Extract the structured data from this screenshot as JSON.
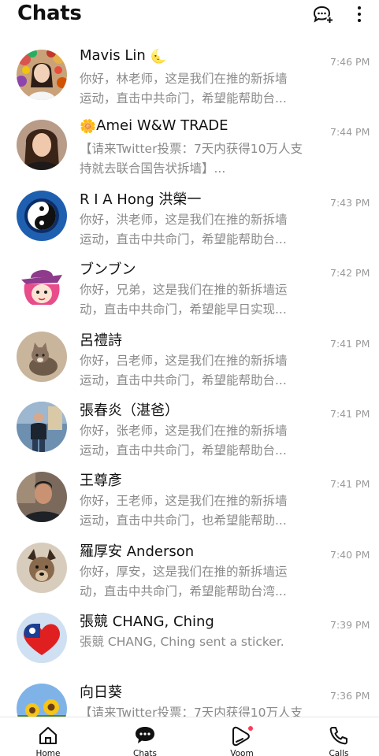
{
  "header": {
    "title": "Chats",
    "new_chat_icon": "chat-plus-icon",
    "more_icon": "more-vertical-icon"
  },
  "chats": [
    {
      "name": "Mavis Lin",
      "emoji": "🌜",
      "line1": "你好，林老师，这是我们在推的新拆墙",
      "line2": "运动，直击中共命门，希望能帮助台...",
      "time": "7:46 PM",
      "avatar": "woman-flowers-avatar"
    },
    {
      "name": "Amei W&W TRADE",
      "emoji": "🌼",
      "line1": "【请来Twitter投票：7天内获得10万人支",
      "line2": "持就去联合国告状拆墙】...",
      "time": "7:44 PM",
      "avatar": "woman-portrait-avatar"
    },
    {
      "name": "R I A Hong 洪榮一",
      "emoji": "",
      "line1": "你好，洪老师，这是我们在推的新拆墙",
      "line2": "运动，直击中共命门，希望能帮助台...",
      "time": "7:43 PM",
      "avatar": "yin-yang-avatar"
    },
    {
      "name": "ブンブン",
      "emoji": "",
      "line1": "你好，兄弟，这是我们在推的新拆墙运",
      "line2": "动，直击中共命门，希望能早日实现...",
      "time": "7:42 PM",
      "avatar": "anime-character-avatar"
    },
    {
      "name": "呂禮詩",
      "emoji": "",
      "line1": "你好，吕老师，这是我们在推的新拆墙",
      "line2": "运动，直击中共命门，希望能帮助台...",
      "time": "7:41 PM",
      "avatar": "cat-avatar"
    },
    {
      "name": "張春炎（湛爸）",
      "emoji": "",
      "line1": "你好，张老师，这是我们在推的新拆墙",
      "line2": "运动，直击中共命门，希望能帮助台...",
      "time": "7:41 PM",
      "avatar": "man-standing-avatar"
    },
    {
      "name": "王尊彥",
      "emoji": "",
      "line1": "你好，王老师，这是我们在推的新拆墙",
      "line2": "运动，直击中共命门，也希望能帮助...",
      "time": "7:41 PM",
      "avatar": "man-portrait-avatar"
    },
    {
      "name": "羅厚安 Anderson",
      "emoji": "",
      "line1": "你好，厚安，这是我们在推的新拆墙运",
      "line2": "动，直击中共命门，希望能帮助台湾...",
      "time": "7:40 PM",
      "avatar": "dog-avatar"
    },
    {
      "name": "張競 CHANG, Ching",
      "emoji": "",
      "line1": "張競 CHANG, Ching sent a sticker.",
      "line2": "",
      "time": "7:39 PM",
      "avatar": "taiwan-flag-heart-avatar"
    },
    {
      "name": "向日葵",
      "emoji": "",
      "line1": "【请来Twitter投票：7天内获得10万人支",
      "line2": "",
      "time": "7:36 PM",
      "avatar": "sunflower-avatar"
    }
  ],
  "tabs": [
    {
      "label": "Home",
      "icon": "home-icon"
    },
    {
      "label": "Chats",
      "icon": "chat-bubble-icon"
    },
    {
      "label": "Voom",
      "icon": "voom-play-icon"
    },
    {
      "label": "Calls",
      "icon": "phone-icon"
    }
  ],
  "colors": {
    "badge": "#ff3b57",
    "preview_text": "#8a8a8a",
    "time_text": "#9a9a9a"
  }
}
